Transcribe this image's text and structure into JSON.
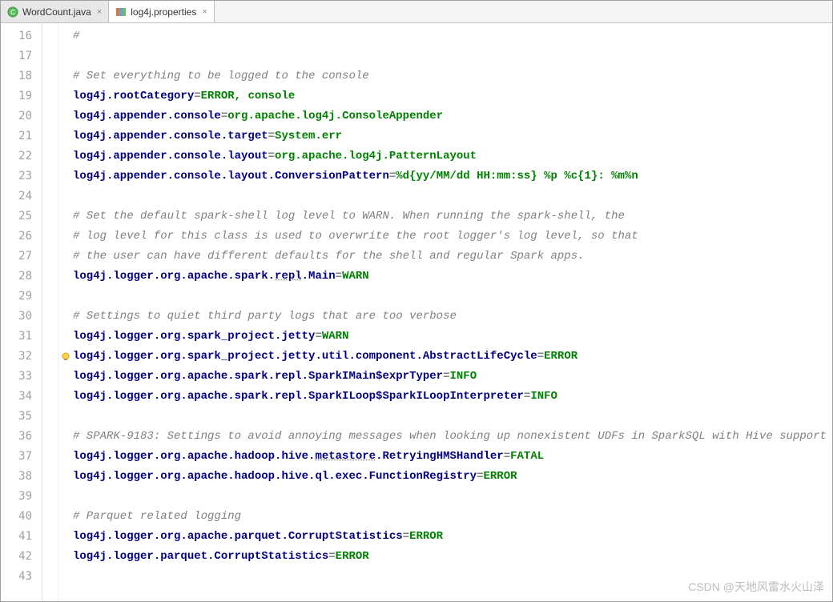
{
  "tabs": [
    {
      "label": "WordCount.java",
      "active": false
    },
    {
      "label": "log4j.properties",
      "active": true
    }
  ],
  "first_line_number": 16,
  "lines": [
    {
      "n": 16,
      "segments": [
        {
          "t": "#",
          "c": "cmt"
        }
      ]
    },
    {
      "n": 17,
      "segments": []
    },
    {
      "n": 18,
      "segments": [
        {
          "t": "# Set everything to be logged to the console",
          "c": "cmt"
        }
      ]
    },
    {
      "n": 19,
      "segments": [
        {
          "t": "log4j.rootCategory",
          "c": "key"
        },
        {
          "t": "=",
          "c": "dl"
        },
        {
          "t": "ERROR, console",
          "c": "val"
        }
      ]
    },
    {
      "n": 20,
      "segments": [
        {
          "t": "log4j.appender.console",
          "c": "key"
        },
        {
          "t": "=",
          "c": "dl"
        },
        {
          "t": "org.apache.log4j.ConsoleAppender",
          "c": "val"
        }
      ]
    },
    {
      "n": 21,
      "segments": [
        {
          "t": "log4j.appender.console.target",
          "c": "key"
        },
        {
          "t": "=",
          "c": "dl"
        },
        {
          "t": "System.err",
          "c": "val"
        }
      ]
    },
    {
      "n": 22,
      "segments": [
        {
          "t": "log4j.appender.console.layout",
          "c": "key"
        },
        {
          "t": "=",
          "c": "dl"
        },
        {
          "t": "org.apache.log4j.PatternLayout",
          "c": "val"
        }
      ]
    },
    {
      "n": 23,
      "segments": [
        {
          "t": "log4j.appender.console.layout.ConversionPattern",
          "c": "key"
        },
        {
          "t": "=",
          "c": "dl"
        },
        {
          "t": "%d{yy/MM/dd HH:mm:ss} %p %c{1}: %m%n",
          "c": "val"
        }
      ]
    },
    {
      "n": 24,
      "segments": []
    },
    {
      "n": 25,
      "segments": [
        {
          "t": "# Set the default spark-shell log level to WARN. When running the spark-shell, the",
          "c": "cmt"
        }
      ]
    },
    {
      "n": 26,
      "segments": [
        {
          "t": "# log level for this class is used to overwrite the root logger's log level, so that",
          "c": "cmt"
        }
      ]
    },
    {
      "n": 27,
      "segments": [
        {
          "t": "# the user can have different defaults for the shell and regular Spark apps.",
          "c": "cmt"
        }
      ]
    },
    {
      "n": 28,
      "segments": [
        {
          "t": "log4j.logger.org.apache.spark.",
          "c": "key"
        },
        {
          "t": "repl",
          "c": "key underline-wavy"
        },
        {
          "t": ".Main",
          "c": "key"
        },
        {
          "t": "=",
          "c": "dl"
        },
        {
          "t": "WARN",
          "c": "val"
        }
      ]
    },
    {
      "n": 29,
      "segments": []
    },
    {
      "n": 30,
      "segments": [
        {
          "t": "# Settings to quiet third party logs that are too verbose",
          "c": "cmt"
        }
      ]
    },
    {
      "n": 31,
      "segments": [
        {
          "t": "log4j.logger.org.spark_project.jetty",
          "c": "key"
        },
        {
          "t": "=",
          "c": "dl"
        },
        {
          "t": "WARN",
          "c": "val"
        }
      ]
    },
    {
      "n": 32,
      "bulb": true,
      "segments": [
        {
          "t": "log4j.logger.org.spark_project.jetty.util.component.AbstractLifeCycle",
          "c": "key"
        },
        {
          "t": "=",
          "c": "dl"
        },
        {
          "t": "ERROR",
          "c": "val"
        }
      ]
    },
    {
      "n": 33,
      "highlight": true,
      "selection": true,
      "segments": [
        {
          "t": "log4j.logger.org.apache.spark.repl.SparkIMain$exprTyper",
          "c": "key"
        },
        {
          "t": "=",
          "c": "dl"
        },
        {
          "t": "INFO",
          "c": "val"
        }
      ]
    },
    {
      "n": 34,
      "segments": [
        {
          "t": "log4j.logger.org.apache.spark.repl.SparkILoop$SparkILoopInterpreter",
          "c": "key"
        },
        {
          "t": "=",
          "c": "dl"
        },
        {
          "t": "INFO",
          "c": "val"
        }
      ]
    },
    {
      "n": 35,
      "segments": []
    },
    {
      "n": 36,
      "segments": [
        {
          "t": "# SPARK-9183: Settings to avoid annoying messages when looking up nonexistent UDFs in SparkSQL with Hive support",
          "c": "cmt"
        }
      ]
    },
    {
      "n": 37,
      "segments": [
        {
          "t": "log4j.logger.org.apache.hadoop.hive.",
          "c": "key"
        },
        {
          "t": "metastore",
          "c": "key underline-wavy"
        },
        {
          "t": ".RetryingHMSHandler",
          "c": "key"
        },
        {
          "t": "=",
          "c": "dl"
        },
        {
          "t": "FATAL",
          "c": "val"
        }
      ]
    },
    {
      "n": 38,
      "segments": [
        {
          "t": "log4j.logger.org.apache.hadoop.hive.ql.exec.FunctionRegistry",
          "c": "key"
        },
        {
          "t": "=",
          "c": "dl"
        },
        {
          "t": "ERROR",
          "c": "val"
        }
      ]
    },
    {
      "n": 39,
      "segments": []
    },
    {
      "n": 40,
      "segments": [
        {
          "t": "# Parquet related logging",
          "c": "cmt"
        }
      ]
    },
    {
      "n": 41,
      "segments": [
        {
          "t": "log4j.logger.org.apache.parquet.CorruptStatistics",
          "c": "key"
        },
        {
          "t": "=",
          "c": "dl"
        },
        {
          "t": "ERROR",
          "c": "val"
        }
      ]
    },
    {
      "n": 42,
      "segments": [
        {
          "t": "log4j.logger.parquet.CorruptStatistics",
          "c": "key"
        },
        {
          "t": "=",
          "c": "dl"
        },
        {
          "t": "ERROR",
          "c": "val"
        }
      ]
    },
    {
      "n": 43,
      "segments": []
    }
  ],
  "watermark": "CSDN @天地风雷水火山泽"
}
